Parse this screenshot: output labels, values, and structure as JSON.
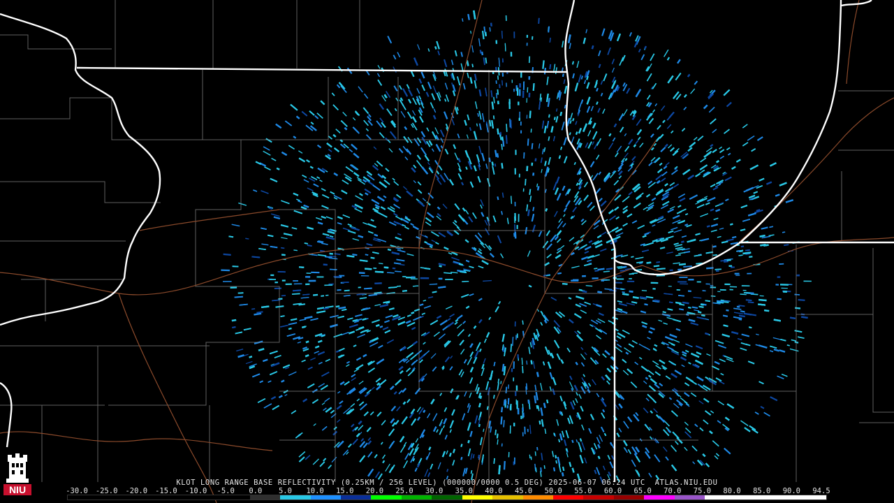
{
  "product_caption": "KLOT LONG RANGE BASE REFLECTIVITY (0.25KM / 256 LEVEL) (000000/0000 0.5 DEG) 2025-06-07 06:24 UTC  ATLAS.NIU.EDU",
  "logo_text": "NIU",
  "colorbar": {
    "labels": [
      "-30.0",
      "-25.0",
      "-20.0",
      "-15.0",
      "-10.0",
      "-5.0",
      "0.0",
      "5.0",
      "10.0",
      "15.0",
      "20.0",
      "25.0",
      "30.0",
      "35.0",
      "40.0",
      "45.0",
      "50.0",
      "55.0",
      "60.0",
      "65.0",
      "70.0",
      "75.0",
      "80.0",
      "85.0",
      "90.0",
      "94.5"
    ],
    "colors": [
      "#000000",
      "#000000",
      "#000000",
      "#000000",
      "#000000",
      "#000000",
      "#2f2f2f",
      "#29c8e6",
      "#1e90ff",
      "#0a2f9a",
      "#00ff00",
      "#00b400",
      "#006400",
      "#ffff00",
      "#e6c000",
      "#ff8c00",
      "#ff0000",
      "#c80000",
      "#960000",
      "#ff00ff",
      "#9955c9",
      "#ffffff",
      "#ffffff",
      "#ffffff",
      "#ffffff"
    ]
  },
  "colors": {
    "background": "#000000",
    "state_border": "#ffffff",
    "county_line": "#8a8a8a",
    "highway": "#8b4a2b",
    "echo_light": "#29c8e6",
    "echo_mid": "#1e88e5",
    "echo_dark": "#0d47a1"
  },
  "radar": {
    "site": "KLOT",
    "product": "Base Reflectivity",
    "dominant_echo_dbz": [
      5,
      15
    ]
  }
}
